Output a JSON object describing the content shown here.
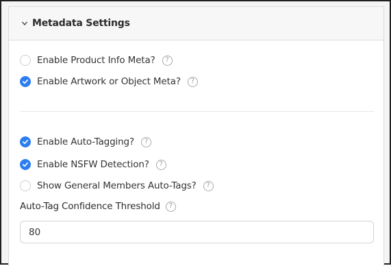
{
  "section": {
    "title": "Metadata Settings",
    "toggle_icon": "chevron-down-icon"
  },
  "group_one": [
    {
      "label": "Enable Product Info Meta?",
      "checked": false
    },
    {
      "label": "Enable Artwork or Object Meta?",
      "checked": true
    }
  ],
  "group_two": [
    {
      "label": "Enable Auto-Tagging?",
      "checked": true
    },
    {
      "label": "Enable NSFW Detection?",
      "checked": true
    },
    {
      "label": "Show General Members Auto-Tags?",
      "checked": false
    }
  ],
  "threshold": {
    "label": "Auto-Tag Confidence Threshold",
    "value": "80"
  },
  "help_glyph": "?",
  "colors": {
    "accent": "#2c7ef0",
    "header_bg": "#f7f7f7",
    "border": "#dcdcdc",
    "text": "#333333"
  }
}
